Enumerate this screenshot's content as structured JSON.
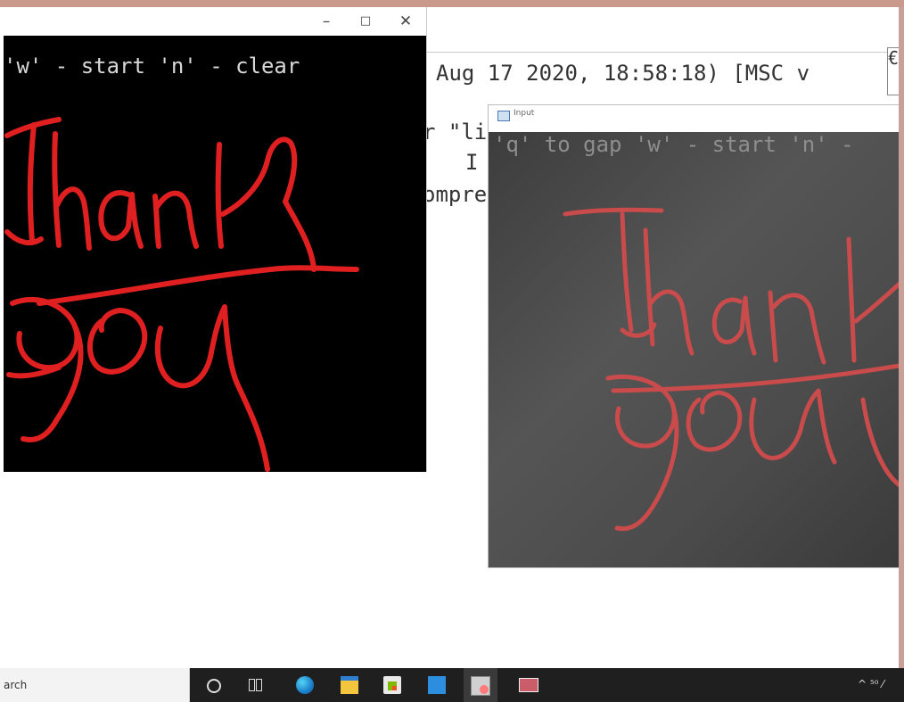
{
  "console": {
    "line1": "Aug 17 2020, 18:58:18) [MSC v",
    "line2": "r \"li",
    "line3": "I",
    "line4": "ompre",
    "boxed_char": "€"
  },
  "paint_window": {
    "minimize": "–",
    "maximize": "□",
    "close": "✕",
    "overlay_text": "'w' - start 'n' - clear"
  },
  "camera_window": {
    "title": "Input",
    "overlay_text": "'q' to gap 'w' - start 'n' -"
  },
  "taskbar": {
    "search_text": "arch",
    "icons": [
      "cortana-icon",
      "task-view-icon",
      "edge-icon",
      "file-explorer-icon",
      "store-icon",
      "mail-icon",
      "paint-app-icon",
      "camera-app-icon"
    ],
    "tray_text": "^ ⁵⁰ ⁄"
  },
  "colors": {
    "ink_left": "#e02020",
    "ink_camera": "#c94b4b",
    "top_strip": "#c99a8c",
    "taskbar": "#1f1f1f"
  }
}
